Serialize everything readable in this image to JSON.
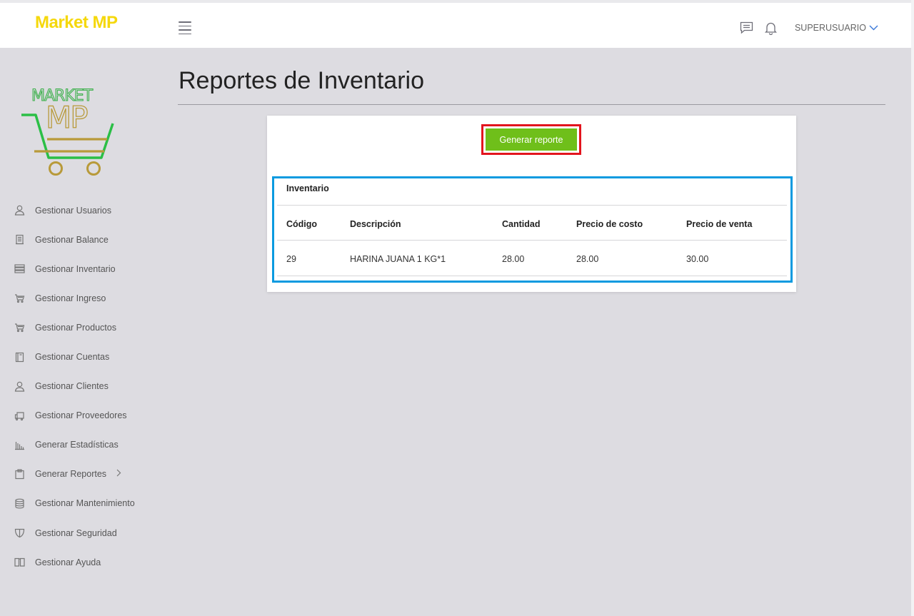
{
  "header": {
    "brand": "Market MP",
    "user_label": "SUPERUSUARIO"
  },
  "logo": {
    "text_top": "MARKET",
    "text_bottom": "MP"
  },
  "sidebar": {
    "items": [
      {
        "label": "Gestionar Usuarios",
        "icon": "user-icon"
      },
      {
        "label": "Gestionar Balance",
        "icon": "receipt-icon"
      },
      {
        "label": "Gestionar Inventario",
        "icon": "server-icon"
      },
      {
        "label": "Gestionar Ingreso",
        "icon": "cart-icon"
      },
      {
        "label": "Gestionar Productos",
        "icon": "cart-icon"
      },
      {
        "label": "Gestionar Cuentas",
        "icon": "book-icon"
      },
      {
        "label": "Gestionar Clientes",
        "icon": "user-icon"
      },
      {
        "label": "Gestionar Proveedores",
        "icon": "truck-icon"
      },
      {
        "label": "Generar Estadísticas",
        "icon": "bar-chart-icon"
      },
      {
        "label": "Generar Reportes",
        "icon": "clipboard-icon"
      },
      {
        "label": "Gestionar Mantenimiento",
        "icon": "database-icon"
      },
      {
        "label": "Gestionar Seguridad",
        "icon": "shield-icon"
      },
      {
        "label": "Gestionar Ayuda",
        "icon": "open-book-icon"
      }
    ]
  },
  "main": {
    "title": "Reportes de Inventario",
    "generate_button": "Generar reporte",
    "table": {
      "caption": "Inventario",
      "columns": [
        "Código",
        "Descripción",
        "Cantidad",
        "Precio de costo",
        "Precio de venta"
      ],
      "rows": [
        [
          "29",
          "HARINA JUANA 1 KG*1",
          "28.00",
          "28.00",
          "30.00"
        ]
      ]
    }
  },
  "colors": {
    "brand": "#f5d80c",
    "button": "#6fbf1a",
    "highlight_red": "#e3141e",
    "highlight_blue": "#0a9ae0",
    "background": "#dddce1"
  }
}
